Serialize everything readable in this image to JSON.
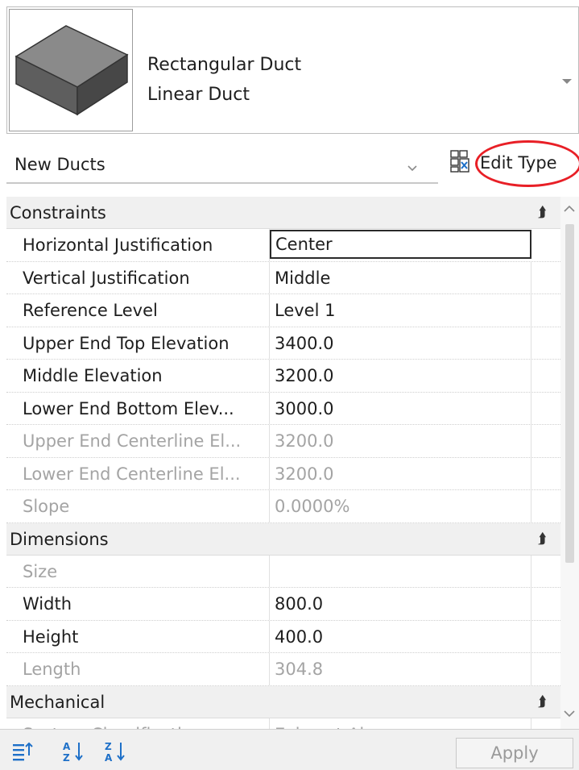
{
  "type_selector": {
    "family": "Rectangular Duct",
    "type": "Linear Duct",
    "thumbnail_icon": "rectangular-duct-3d-icon",
    "dropdown_icon": "chevron-down-icon"
  },
  "instance_filter": {
    "value": "New Ducts",
    "dropdown_icon": "chevron-down-icon"
  },
  "edit_type": {
    "label": "Edit Type",
    "icon": "edit-type-icon",
    "highlight_color": "#e81f26"
  },
  "categories": [
    {
      "name": "Constraints",
      "collapse_icon": "double-chevron-up-icon",
      "properties": [
        {
          "name": "Horizontal Justification",
          "value": "Center",
          "editable": true,
          "editing": true
        },
        {
          "name": "Vertical Justification",
          "value": "Middle",
          "editable": true
        },
        {
          "name": "Reference Level",
          "value": "Level 1",
          "editable": true
        },
        {
          "name": "Upper End Top Elevation",
          "value": "3400.0",
          "editable": true
        },
        {
          "name": "Middle Elevation",
          "value": "3200.0",
          "editable": true
        },
        {
          "name": "Lower End Bottom Elev...",
          "value": "3000.0",
          "editable": true
        },
        {
          "name": "Upper End Centerline El...",
          "value": "3200.0",
          "editable": false
        },
        {
          "name": "Lower End Centerline El...",
          "value": "3200.0",
          "editable": false
        },
        {
          "name": "Slope",
          "value": "0.0000%",
          "editable": false
        }
      ]
    },
    {
      "name": "Dimensions",
      "collapse_icon": "double-chevron-up-icon",
      "properties": [
        {
          "name": "Size",
          "value": "",
          "editable": false
        },
        {
          "name": "Width",
          "value": "800.0",
          "editable": true
        },
        {
          "name": "Height",
          "value": "400.0",
          "editable": true
        },
        {
          "name": "Length",
          "value": "304.8",
          "editable": false
        }
      ]
    },
    {
      "name": "Mechanical",
      "collapse_icon": "double-chevron-up-icon",
      "properties": [
        {
          "name": "System Classification",
          "value": "Exhaust Air",
          "editable": false
        }
      ]
    }
  ],
  "toolbar": {
    "buttons": [
      {
        "icon": "categorize-icon"
      },
      {
        "icon": "sort-ascending-icon"
      },
      {
        "icon": "sort-descending-icon"
      }
    ],
    "apply_label": "Apply"
  },
  "colors": {
    "accent_blue": "#1e70c8",
    "disabled_text": "#a4a4a4",
    "category_bg": "#f0f0f0"
  }
}
